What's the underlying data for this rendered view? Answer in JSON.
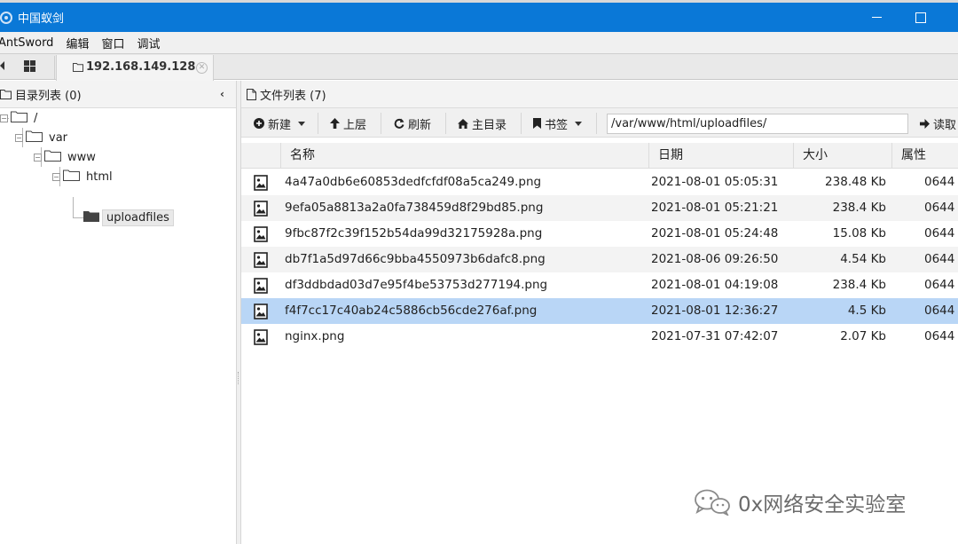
{
  "window": {
    "title": "中国蚁剑"
  },
  "menu": {
    "items": [
      "AntSword",
      "编辑",
      "窗口",
      "调试"
    ]
  },
  "tabs": {
    "active_label": "192.168.149.128",
    "close_glyph": "✕"
  },
  "left": {
    "title": "目录列表 (0)",
    "collapse_glyph": "‹",
    "tree": [
      {
        "label": "/",
        "level": 0
      },
      {
        "label": "var",
        "level": 1
      },
      {
        "label": "www",
        "level": 2
      },
      {
        "label": "html",
        "level": 3
      },
      {
        "label": "uploadfiles",
        "level": 4,
        "selected": true
      }
    ]
  },
  "right": {
    "title": "文件列表 (7)",
    "toolbar": {
      "new": "新建",
      "up": "上层",
      "refresh": "刷新",
      "home": "主目录",
      "bookmark": "书签",
      "path": "/var/www/html/uploadfiles/",
      "read": "读取"
    },
    "columns": {
      "name": "名称",
      "date": "日期",
      "size": "大小",
      "attr": "属性"
    },
    "files": [
      {
        "name": "4a47a0db6e60853dedfcfdf08a5ca249.png",
        "date": "2021-08-01 05:05:31",
        "size": "238.48 Kb",
        "attr": "0644"
      },
      {
        "name": "9efa05a8813a2a0fa738459d8f29bd85.png",
        "date": "2021-08-01 05:21:21",
        "size": "238.4 Kb",
        "attr": "0644"
      },
      {
        "name": "9fbc87f2c39f152b54da99d32175928a.png",
        "date": "2021-08-01 05:24:48",
        "size": "15.08 Kb",
        "attr": "0644"
      },
      {
        "name": "db7f1a5d97d66c9bba4550973b6dafc8.png",
        "date": "2021-08-06 09:26:50",
        "size": "4.54 Kb",
        "attr": "0644"
      },
      {
        "name": "df3ddbdad03d7e95f4be53753d277194.png",
        "date": "2021-08-01 04:19:08",
        "size": "238.4 Kb",
        "attr": "0644"
      },
      {
        "name": "f4f7cc17c40ab24c5886cb56cde276af.png",
        "date": "2021-08-01 12:36:27",
        "size": "4.5 Kb",
        "attr": "0644",
        "selected": true
      },
      {
        "name": "nginx.png",
        "date": "2021-07-31 07:42:07",
        "size": "2.07 Kb",
        "attr": "0644"
      }
    ]
  },
  "watermark": {
    "text": "0x网络安全实验室"
  },
  "colors": {
    "titlebar": "#0a78d7",
    "selected_row": "#b9d6f6"
  }
}
